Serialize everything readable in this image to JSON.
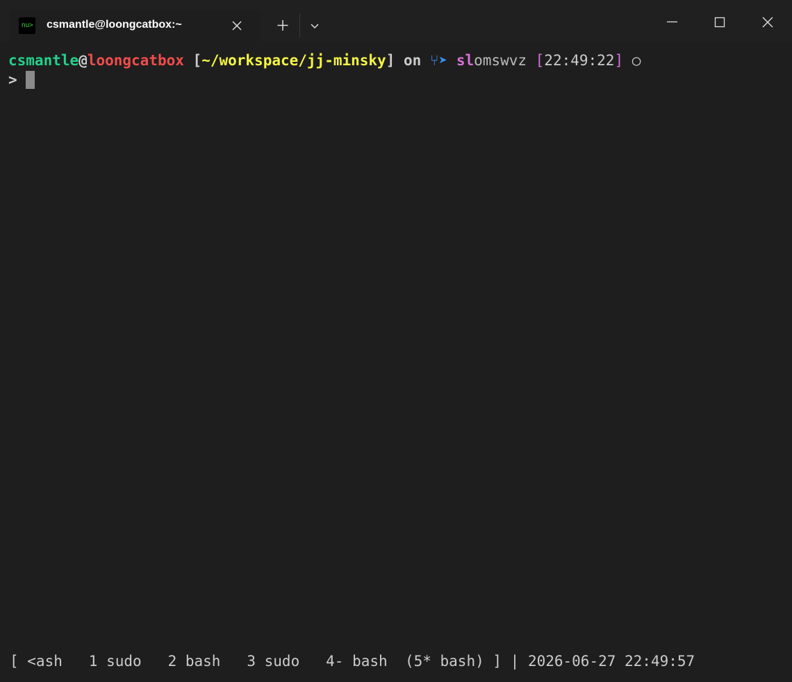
{
  "titlebar": {
    "tab_icon_text": "nu>",
    "tab_title": "csmantle@loongcatbox:~",
    "icons": {
      "tab_close": "close-icon",
      "new_tab": "plus-icon",
      "dropdown": "chevron-down-icon",
      "minimize": "minimize-icon",
      "maximize": "maximize-icon",
      "close": "close-icon"
    }
  },
  "prompt": {
    "user": "csmantle",
    "at": "@",
    "host": "loongcatbox",
    "dir_open": " [",
    "dir": "~/workspace/jj-minsky",
    "dir_close": "]",
    "on": " on ",
    "vcs_icon": "⑂➤",
    "change_id_prefix": "sl",
    "change_id_rest": "omswvz",
    "time_open": " [",
    "time": "22:49:22",
    "time_close": "]",
    "status_symbol": " ○"
  },
  "input": {
    "indicator": "> "
  },
  "statusbar": {
    "text": "[ <ash   1 sudo   2 bash   3 sudo   4- bash  (5* bash) ] | 2026-06-27 22:49:57"
  },
  "colors": {
    "background": "#1e1e1e",
    "titlebar": "#202020",
    "user": "#23d18b",
    "host": "#f14c4c",
    "directory": "#f5f543",
    "vcs_icon": "#3b8eea",
    "change_id": "#d670d6",
    "time_bracket": "#d670d6"
  }
}
